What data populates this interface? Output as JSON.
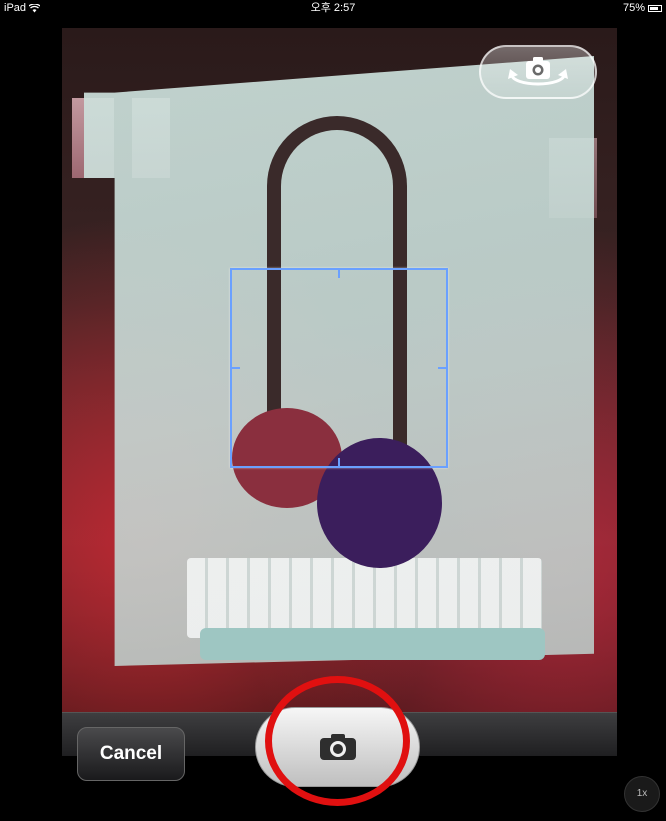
{
  "status_bar": {
    "device": "iPad",
    "time": "오후 2:57",
    "battery": "75%",
    "battery_level": 0.75
  },
  "camera": {
    "flip_camera_icon": "camera-flip-icon",
    "focus_box_icon": "focus-reticle"
  },
  "toolbar": {
    "cancel_label": "Cancel",
    "shutter_icon": "camera-icon",
    "zoom_label": "1x"
  },
  "colors": {
    "focus_box": "#6aa0ff",
    "highlight_circle": "#e01010",
    "toolbar_bg": "#2a2a2c"
  }
}
